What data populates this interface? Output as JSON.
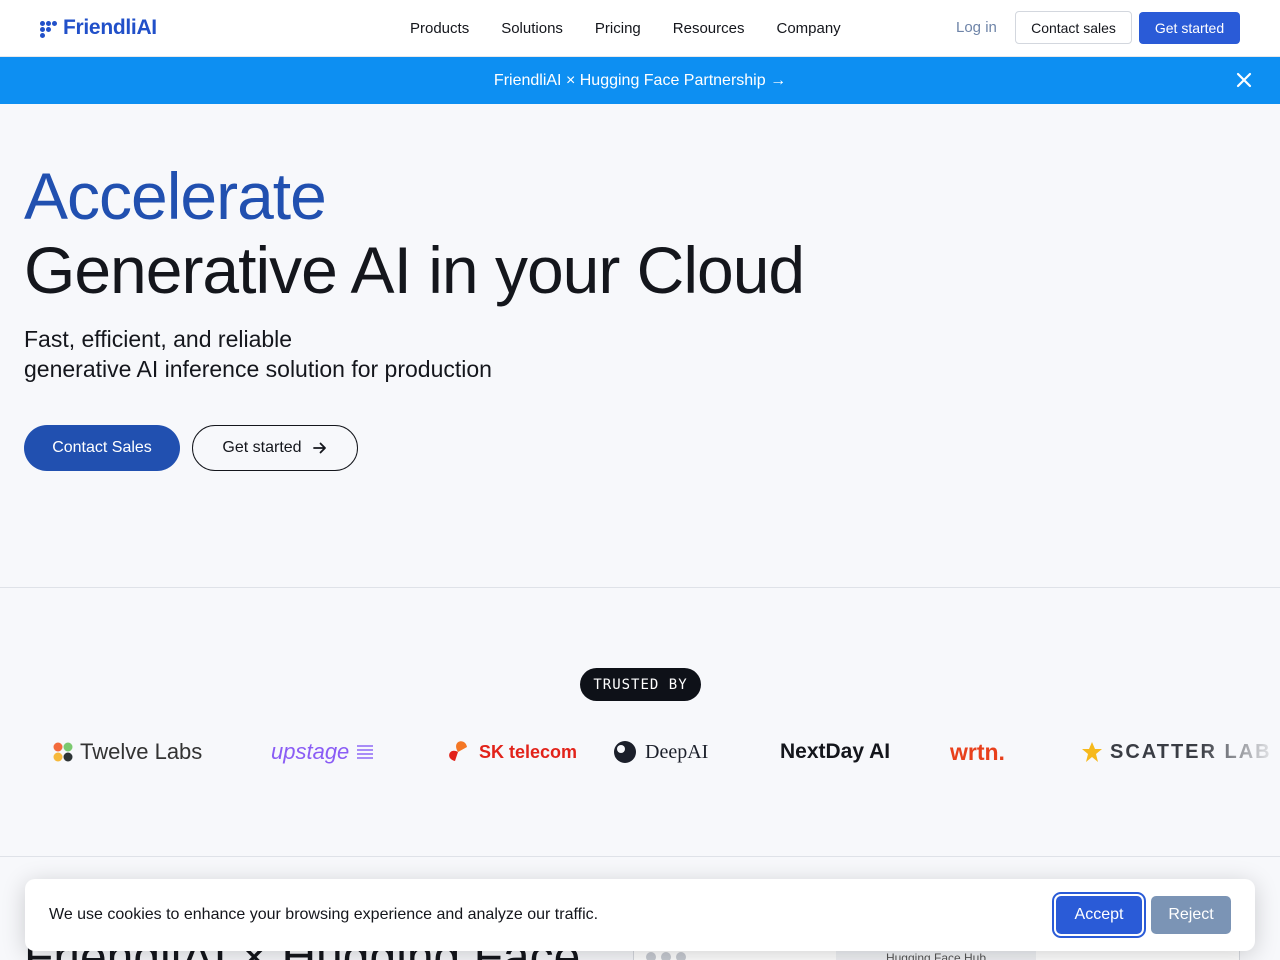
{
  "header": {
    "logo_text": "FriendliAI",
    "nav": [
      "Products",
      "Solutions",
      "Pricing",
      "Resources",
      "Company"
    ],
    "login": "Log in",
    "contact_sales": "Contact sales",
    "get_started": "Get started"
  },
  "banner": {
    "text": "FriendliAI × Hugging Face Partnership →",
    "close_icon": "close-icon"
  },
  "hero": {
    "title_line1": "Accelerate",
    "title_line2": "Generative AI in your Cloud",
    "subtitle_line1": "Fast, efficient, and reliable",
    "subtitle_line2": "generative AI inference solution for production",
    "contact_sales": "Contact Sales",
    "get_started": "Get started"
  },
  "trusted": {
    "label": "TRUSTED BY",
    "logos": [
      "Twelve Labs",
      "upstage",
      "SK telecom",
      "DeepAI",
      "NextDay AI",
      "wrtn.",
      "SCATTER LAB"
    ]
  },
  "next_section": {
    "title_partial": "FriendliAI × Hugging Face",
    "panel_url": "Hugging Face Hub"
  },
  "cookie": {
    "text": "We use cookies to enhance your browsing experience and analyze our traffic.",
    "accept": "Accept",
    "reject": "Reject"
  },
  "colors": {
    "brand": "#2150b0",
    "primary_button": "#2a5bd7",
    "banner": "#0d8ff2",
    "reject_button": "#7b94b5"
  }
}
